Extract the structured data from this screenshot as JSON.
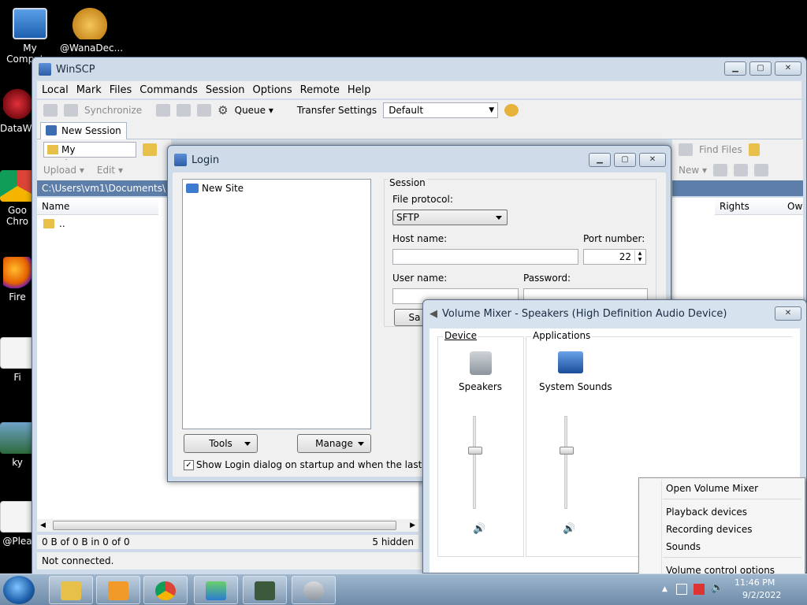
{
  "desktop": {
    "icons": [
      {
        "label": "My Computer",
        "icon": "computer-icon"
      },
      {
        "label": "@WanaDec...",
        "icon": "handshake-icon"
      },
      {
        "label": "DataWa",
        "icon": "app-icon"
      },
      {
        "label": "Goo Chro",
        "icon": "chrome-icon"
      },
      {
        "label": "Fire",
        "icon": "firefox-icon"
      },
      {
        "label": "Fi",
        "icon": "file-icon"
      },
      {
        "label": "ky",
        "icon": "image-icon"
      },
      {
        "label": "@Plea",
        "icon": "file-icon"
      }
    ]
  },
  "winscp": {
    "title": "WinSCP",
    "menu": [
      "Local",
      "Mark",
      "Files",
      "Commands",
      "Session",
      "Options",
      "Remote",
      "Help"
    ],
    "toolbar": {
      "synchronize": "Synchronize",
      "queue": "Queue",
      "transfer_settings_label": "Transfer Settings",
      "transfer_settings_value": "Default"
    },
    "tab": "New Session",
    "local": {
      "location": "My documents",
      "upload": "Upload",
      "edit": "Edit",
      "path": "C:\\Users\\vm1\\Documents\\",
      "col_name": "Name",
      "parent": "..",
      "status_left": "0 B of 0 B in 0 of 0",
      "status_right": "5 hidden"
    },
    "remote": {
      "find_files": "Find Files",
      "new": "New",
      "col_rights": "Rights",
      "col_owner": "Own"
    },
    "status": "Not connected."
  },
  "login": {
    "title": "Login",
    "tree_item": "New Site",
    "session_group": "Session",
    "file_protocol_label": "File protocol:",
    "file_protocol_value": "SFTP",
    "host_label": "Host name:",
    "host_value": "",
    "port_label": "Port number:",
    "port_value": "22",
    "user_label": "User name:",
    "password_label": "Password:",
    "save_label": "Sa",
    "tools": "Tools",
    "manage": "Manage",
    "show_login": "Show Login dialog on startup and when the last session is clo"
  },
  "mixer": {
    "title": "Volume Mixer - Speakers (High Definition Audio Device)",
    "device_group": "Device",
    "apps_group": "Applications",
    "device_name": "Speakers",
    "app_name": "System Sounds",
    "speakers_level": 0.63,
    "system_sounds_level": 0.63
  },
  "context_menu": {
    "items": [
      "Open Volume Mixer",
      "Playback devices",
      "Recording devices",
      "Sounds",
      "Volume control options"
    ]
  },
  "taskbar": {
    "time": "11:46 PM",
    "date": "9/2/2022"
  },
  "colors": {
    "accent": "#5d7ea8",
    "taskbar": "#6d8aa8"
  }
}
